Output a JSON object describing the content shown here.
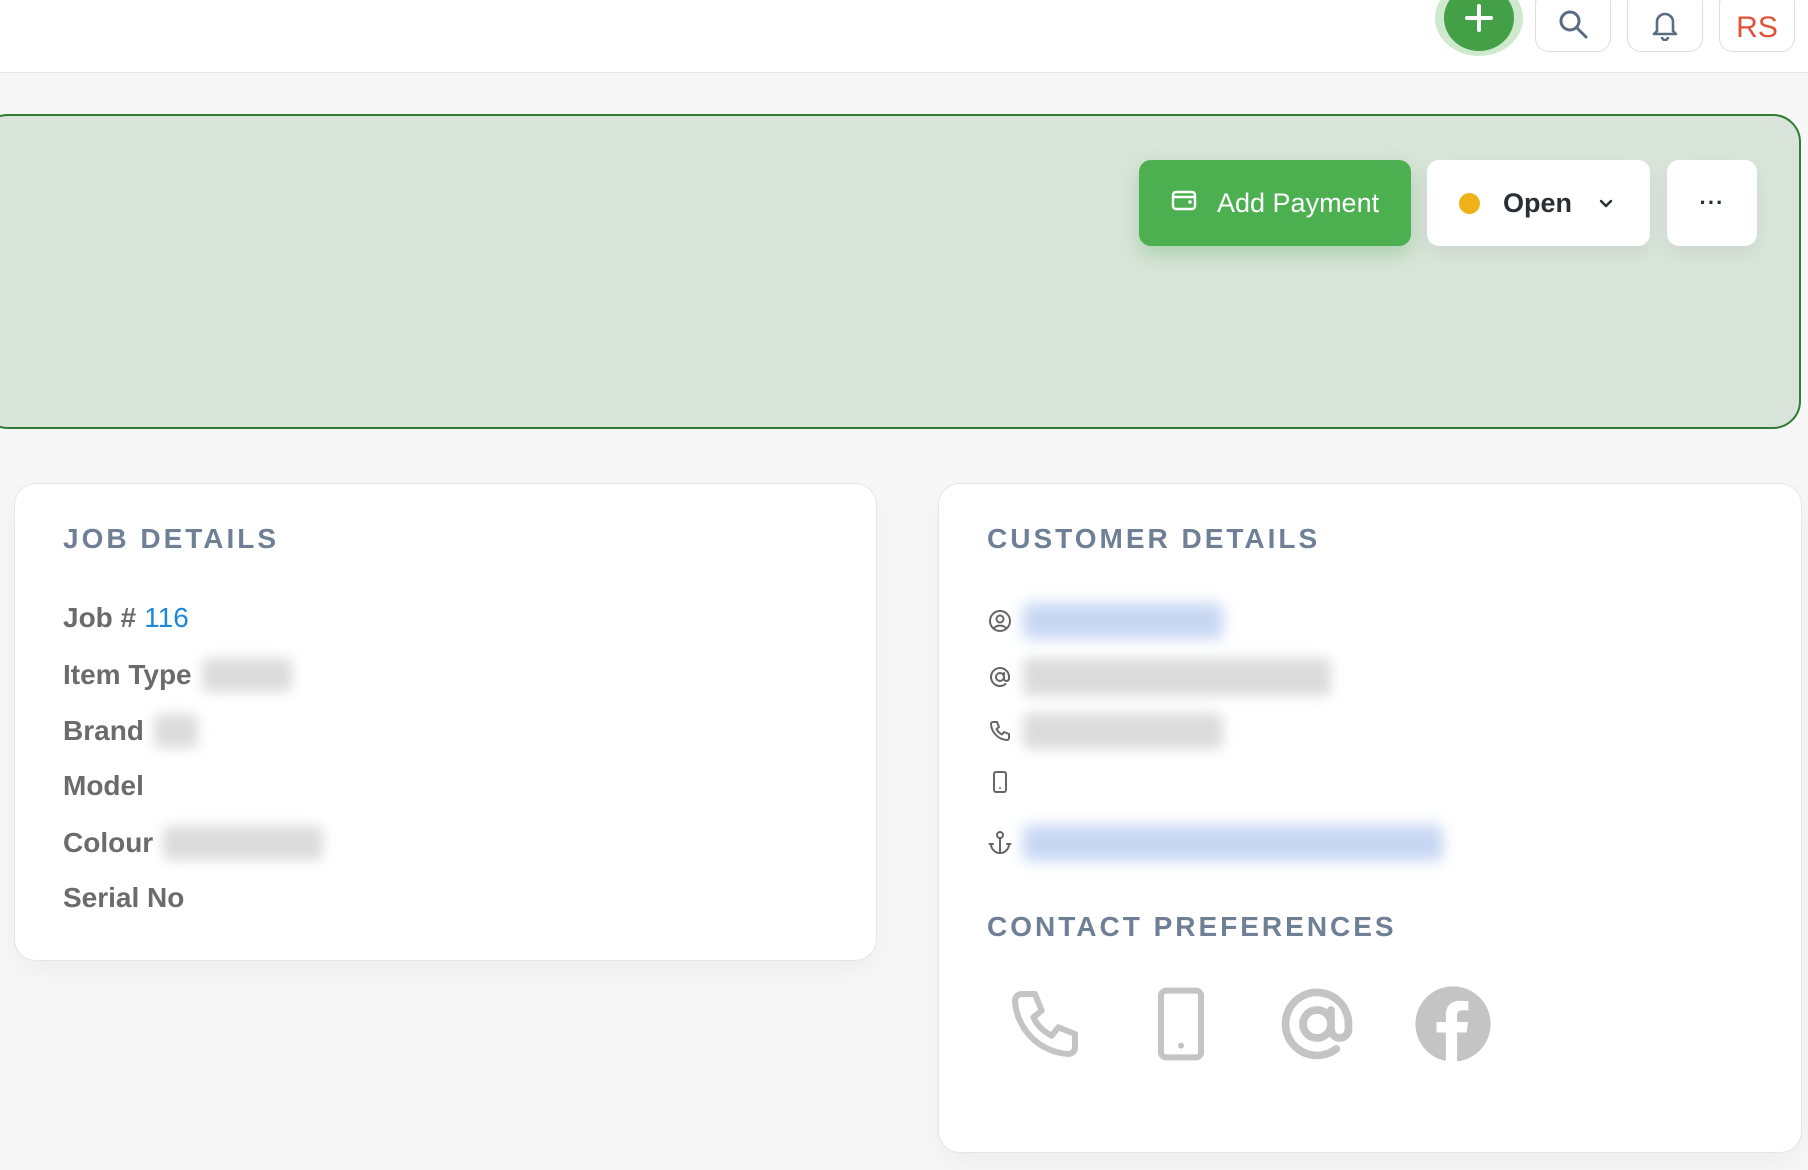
{
  "topbar": {
    "add_label": "Add",
    "avatar_initials": "RS"
  },
  "banner": {
    "add_payment_label": "Add Payment",
    "status_label": "Open",
    "status_color": "#f0b21b",
    "more_label": "···"
  },
  "job_details": {
    "title": "JOB DETAILS",
    "job_label": "Job #",
    "job_number": "116",
    "item_type_label": "Item Type",
    "brand_label": "Brand",
    "model_label": "Model",
    "colour_label": "Colour",
    "serial_label": "Serial No"
  },
  "customer_details": {
    "title": "CUSTOMER DETAILS",
    "rows": [
      {
        "icon": "user-circle-icon"
      },
      {
        "icon": "at-icon"
      },
      {
        "icon": "phone-icon"
      },
      {
        "icon": "mobile-icon"
      },
      {
        "icon": "anchor-icon"
      }
    ]
  },
  "contact_preferences": {
    "title": "CONTACT PREFERENCES",
    "options": [
      "phone-icon",
      "mobile-icon",
      "at-icon",
      "facebook-icon"
    ]
  },
  "colors": {
    "accent_green": "#4caf50",
    "banner_bg": "#d9e4da",
    "banner_border": "#2e7d32",
    "heading_gray_blue": "#6e7f96",
    "link_blue": "#1e88d8",
    "avatar_red": "#e0533a"
  }
}
